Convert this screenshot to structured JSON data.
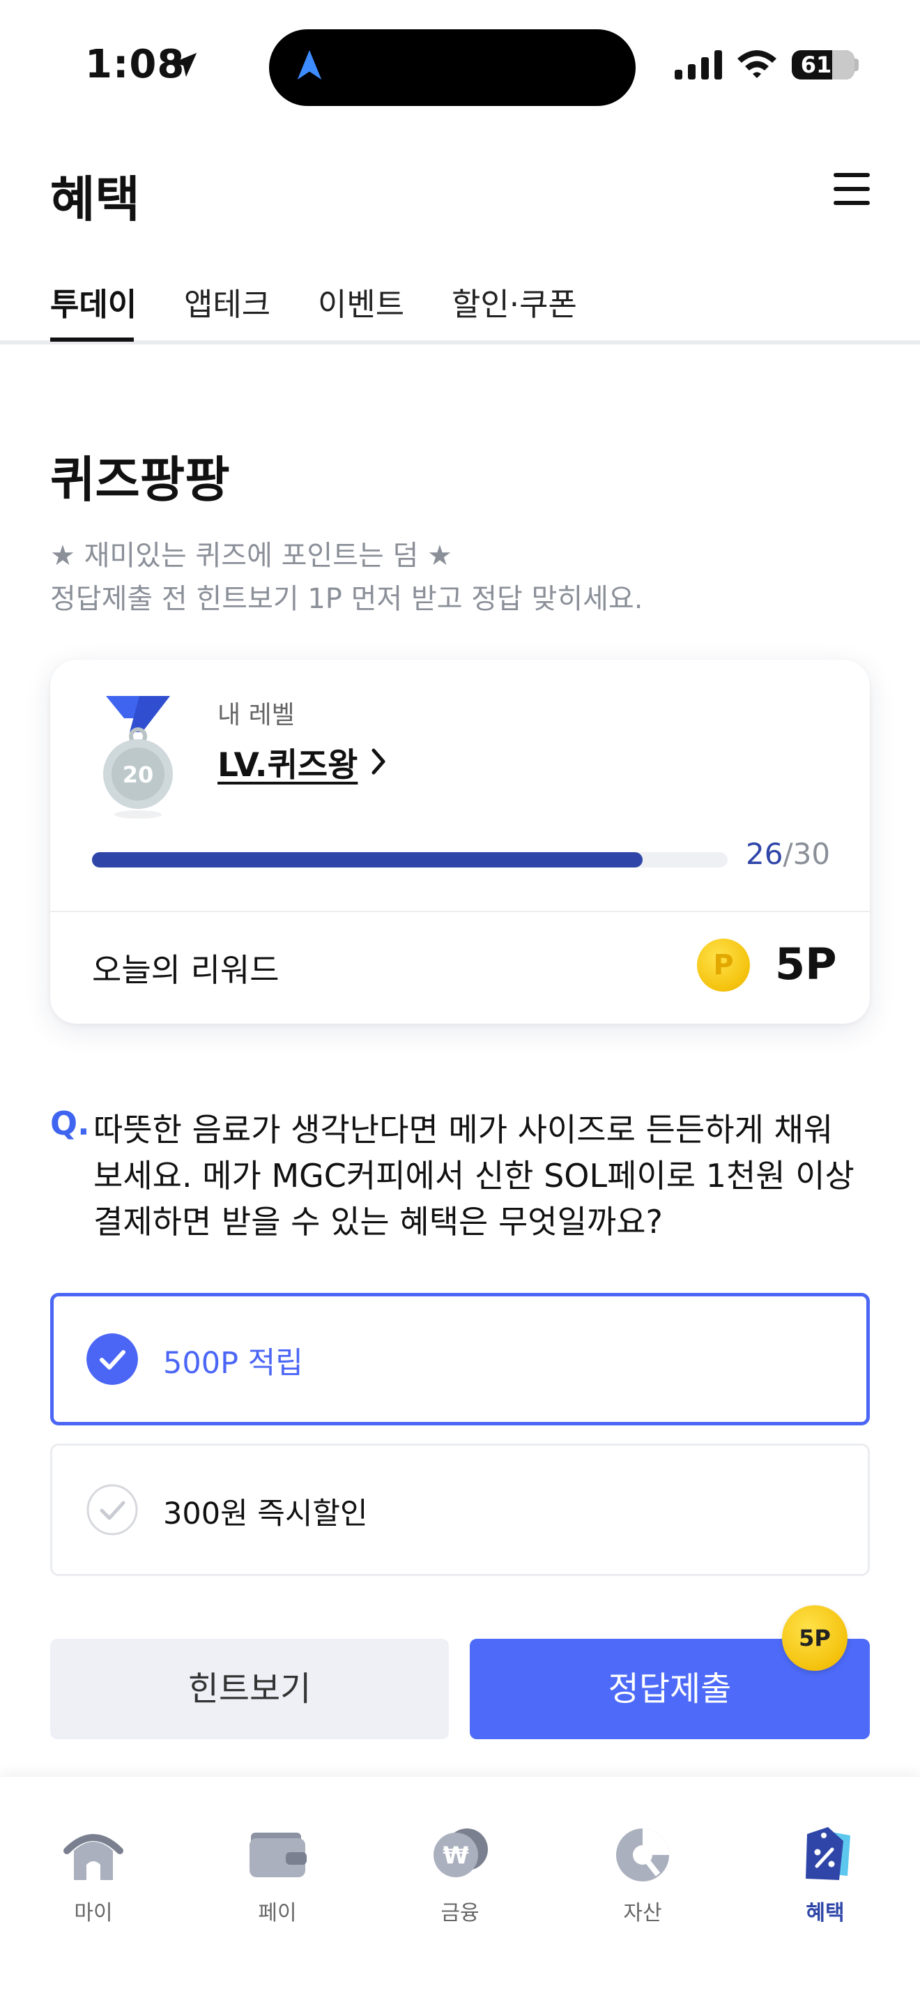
{
  "status_bar": {
    "time": "1:08",
    "battery": "61"
  },
  "header": {
    "title": "혜택"
  },
  "tabs": [
    {
      "label": "투데이",
      "active": true
    },
    {
      "label": "앱테크",
      "active": false
    },
    {
      "label": "이벤트",
      "active": false
    },
    {
      "label": "할인·쿠폰",
      "active": false
    }
  ],
  "quiz": {
    "title": "퀴즈팡팡",
    "desc_line1": "★ 재미있는 퀴즈에 포인트는 덤 ★",
    "desc_line2": "정답제출 전 힌트보기 1P 먼저 받고 정답 맞히세요."
  },
  "level_card": {
    "medal_number": "20",
    "label": "내 레벨",
    "level_name": "LV.퀴즈왕",
    "progress_current": "26",
    "progress_total": "/30",
    "progress_fraction": 0.8667,
    "reward_label": "오늘의 리워드",
    "reward_coin": "P",
    "reward_value": "5P"
  },
  "question": {
    "prefix": "Q.",
    "line1": "따뜻한 음료가 생각난다면 메가 사이즈로 든든하게 채워",
    "line2": "보세요. 메가 MGC커피에서 신한 SOL페이로 1천원 이상",
    "line3": "결제하면 받을 수 있는 혜택은 무엇일까요?"
  },
  "options": [
    {
      "label": "500P 적립",
      "selected": true
    },
    {
      "label": "300원 즉시할인",
      "selected": false
    }
  ],
  "buttons": {
    "hint": "힌트보기",
    "submit": "정답제출",
    "submit_badge": "5P"
  },
  "bottom_nav": [
    {
      "label": "마이",
      "icon": "home-icon",
      "active": false
    },
    {
      "label": "페이",
      "icon": "wallet-icon",
      "active": false
    },
    {
      "label": "금융",
      "icon": "won-coin-icon",
      "active": false
    },
    {
      "label": "자산",
      "icon": "pie-chart-icon",
      "active": false
    },
    {
      "label": "혜택",
      "icon": "benefit-tag-icon",
      "active": true
    }
  ],
  "colors": {
    "accent": "#4d6bf8",
    "progress": "#2f46a8",
    "selected_border": "#4b66f5",
    "coin": "#f4c20d"
  }
}
